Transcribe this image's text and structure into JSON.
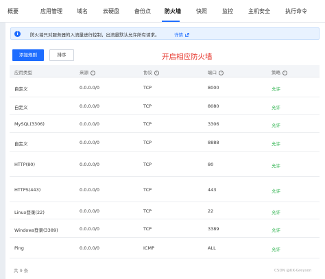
{
  "tabs": [
    "概要",
    "应用管理",
    "域名",
    "云硬盘",
    "备份点",
    "防火墙",
    "快照",
    "监控",
    "主机安全",
    "执行命令"
  ],
  "active_tab": "防火墙",
  "notice": {
    "icon": "info-icon",
    "text": "防火墙只对服务器的入流量进行控制，出流量默认允许所有请求。",
    "link": "详情",
    "link_icon": "external-link-icon"
  },
  "toolbar": {
    "add_label": "添加规则",
    "sort_label": "排序"
  },
  "annotation": "开启相应防火墙",
  "table": {
    "headers": {
      "app_type": "应用类型",
      "source": "来源",
      "protocol": "协议",
      "port": "端口",
      "policy": "策略"
    },
    "rows": [
      {
        "app_type": "自定义",
        "source": "0.0.0.0/0",
        "protocol": "TCP",
        "port": "8000",
        "policy": "允许"
      },
      {
        "app_type": "自定义",
        "source": "0.0.0.0/0",
        "protocol": "TCP",
        "port": "8080",
        "policy": "允许"
      },
      {
        "app_type": "MySQL(3306)",
        "source": "0.0.0.0/0",
        "protocol": "TCP",
        "port": "3306",
        "policy": "允许"
      },
      {
        "app_type": "自定义",
        "source": "0.0.0.0/0",
        "protocol": "TCP",
        "port": "8888",
        "policy": "允许"
      },
      {
        "app_type": "HTTP(80)",
        "source": "0.0.0.0/0",
        "protocol": "TCP",
        "port": "80",
        "policy": "允许"
      },
      {
        "app_type": "HTTPS(443)",
        "source": "0.0.0.0/0",
        "protocol": "TCP",
        "port": "443",
        "policy": "允许"
      },
      {
        "app_type": "Linux登录(22)",
        "source": "0.0.0.0/0",
        "protocol": "TCP",
        "port": "22",
        "policy": "允许"
      },
      {
        "app_type": "Windows登录(3389)",
        "source": "0.0.0.0/0",
        "protocol": "TCP",
        "port": "3389",
        "policy": "允许"
      },
      {
        "app_type": "Ping",
        "source": "0.0.0.0/0",
        "protocol": "ICMP",
        "port": "ALL",
        "policy": "允许"
      }
    ]
  },
  "footer": {
    "count": "共 9 条"
  },
  "watermark": "CSDN @KK-Greyson",
  "colors": {
    "accent": "#1e6dff",
    "allow": "#2bb24c",
    "annotation": "#e5342a"
  }
}
